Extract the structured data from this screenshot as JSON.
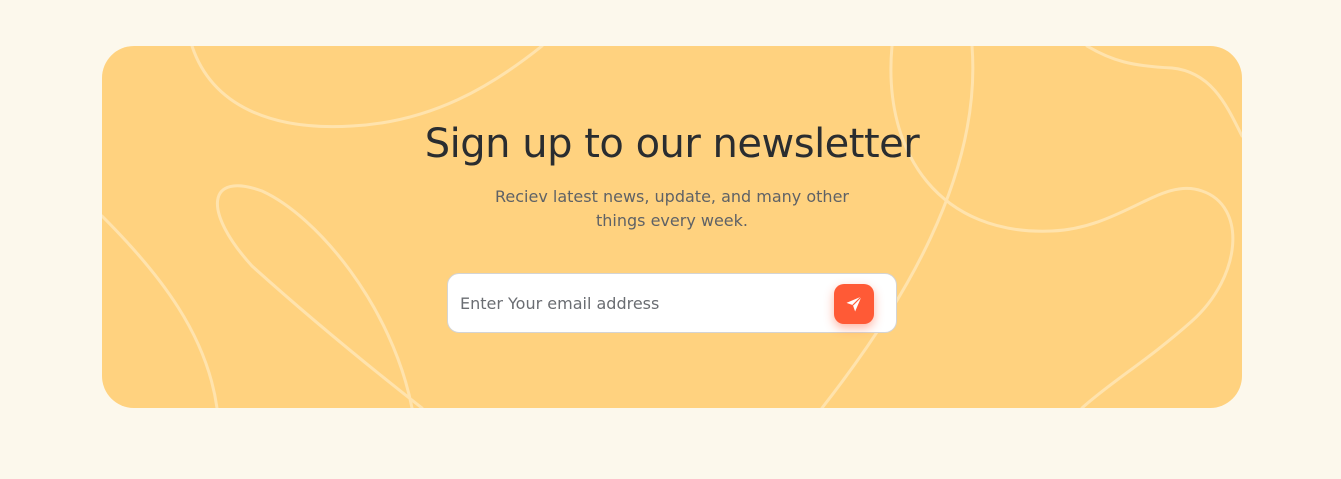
{
  "newsletter": {
    "title": "Sign up to our newsletter",
    "subtitle": "Reciev latest news, update, and many other things every week.",
    "email_placeholder": "Enter Your email address",
    "email_value": "",
    "submit_icon": "send-icon"
  },
  "colors": {
    "page_background": "#fcf8ec",
    "card_background": "#ffd27f",
    "title_text": "#2a2d30",
    "subtitle_text": "#5f6266",
    "accent": "#ff5a36",
    "input_background": "#ffffff"
  }
}
